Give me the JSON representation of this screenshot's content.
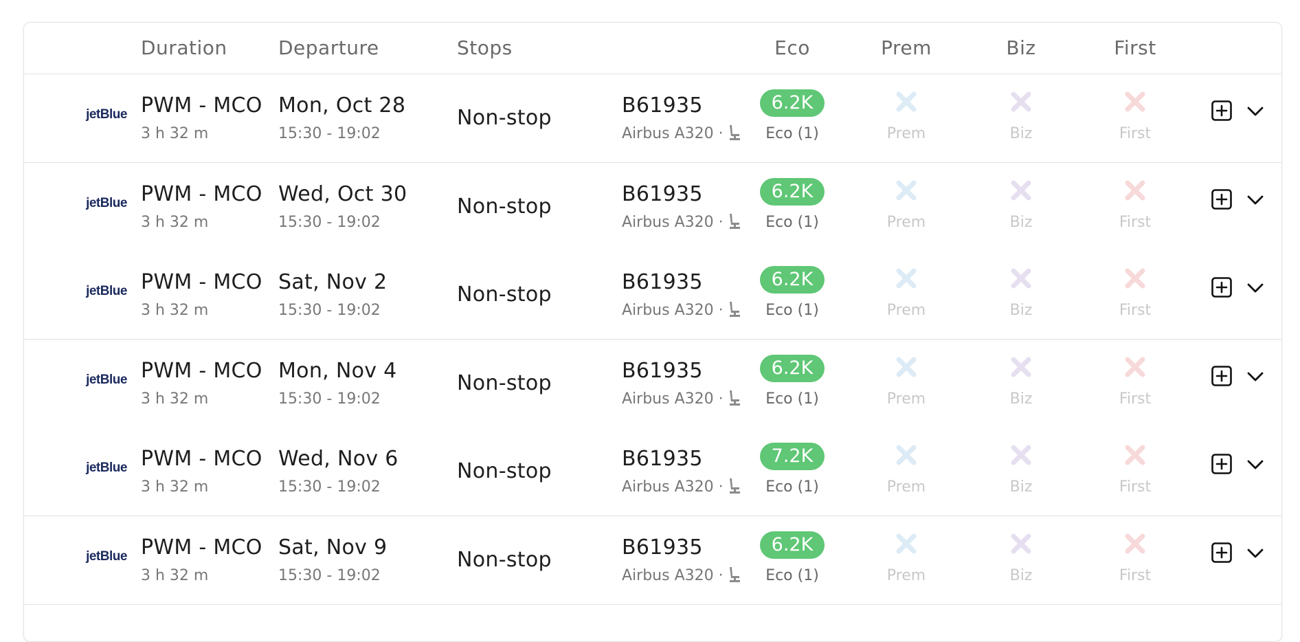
{
  "header": {
    "duration": "Duration",
    "departure": "Departure",
    "stops": "Stops",
    "eco": "Eco",
    "prem": "Prem",
    "biz": "Biz",
    "first": "First"
  },
  "colors": {
    "eco_pill": "#5fc775",
    "prem_x": "#dcebf5",
    "biz_x": "#e6dff0",
    "first_x": "#f7d9d9",
    "airline_logo": "#1b2a5e"
  },
  "icons": {
    "seat": "seat-icon",
    "unavailable": "x-icon",
    "add": "plus-square-icon",
    "expand": "chevron-down-icon"
  },
  "rows": [
    {
      "airline": "jetBlue",
      "route": "PWM - MCO",
      "duration": "3 h 32 m",
      "date": "Mon, Oct 28",
      "time": "15:30 - 19:02",
      "stops": "Non-stop",
      "flight": "B61935",
      "aircraft": "Airbus A320 ·",
      "eco_price": "6.2K",
      "eco_label": "Eco (1)",
      "prem_label": "Prem",
      "biz_label": "Biz",
      "first_label": "First"
    },
    {
      "airline": "jetBlue",
      "route": "PWM - MCO",
      "duration": "3 h 32 m",
      "date": "Wed, Oct 30",
      "time": "15:30 - 19:02",
      "stops": "Non-stop",
      "flight": "B61935",
      "aircraft": "Airbus A320 ·",
      "eco_price": "6.2K",
      "eco_label": "Eco (1)",
      "prem_label": "Prem",
      "biz_label": "Biz",
      "first_label": "First"
    },
    {
      "airline": "jetBlue",
      "route": "PWM - MCO",
      "duration": "3 h 32 m",
      "date": "Sat, Nov 2",
      "time": "15:30 - 19:02",
      "stops": "Non-stop",
      "flight": "B61935",
      "aircraft": "Airbus A320 ·",
      "eco_price": "6.2K",
      "eco_label": "Eco (1)",
      "prem_label": "Prem",
      "biz_label": "Biz",
      "first_label": "First"
    },
    {
      "airline": "jetBlue",
      "route": "PWM - MCO",
      "duration": "3 h 32 m",
      "date": "Mon, Nov 4",
      "time": "15:30 - 19:02",
      "stops": "Non-stop",
      "flight": "B61935",
      "aircraft": "Airbus A320 ·",
      "eco_price": "6.2K",
      "eco_label": "Eco (1)",
      "prem_label": "Prem",
      "biz_label": "Biz",
      "first_label": "First"
    },
    {
      "airline": "jetBlue",
      "route": "PWM - MCO",
      "duration": "3 h 32 m",
      "date": "Wed, Nov 6",
      "time": "15:30 - 19:02",
      "stops": "Non-stop",
      "flight": "B61935",
      "aircraft": "Airbus A320 ·",
      "eco_price": "7.2K",
      "eco_label": "Eco (1)",
      "prem_label": "Prem",
      "biz_label": "Biz",
      "first_label": "First"
    },
    {
      "airline": "jetBlue",
      "route": "PWM - MCO",
      "duration": "3 h 32 m",
      "date": "Sat, Nov 9",
      "time": "15:30 - 19:02",
      "stops": "Non-stop",
      "flight": "B61935",
      "aircraft": "Airbus A320 ·",
      "eco_price": "6.2K",
      "eco_label": "Eco (1)",
      "prem_label": "Prem",
      "biz_label": "Biz",
      "first_label": "First"
    }
  ]
}
